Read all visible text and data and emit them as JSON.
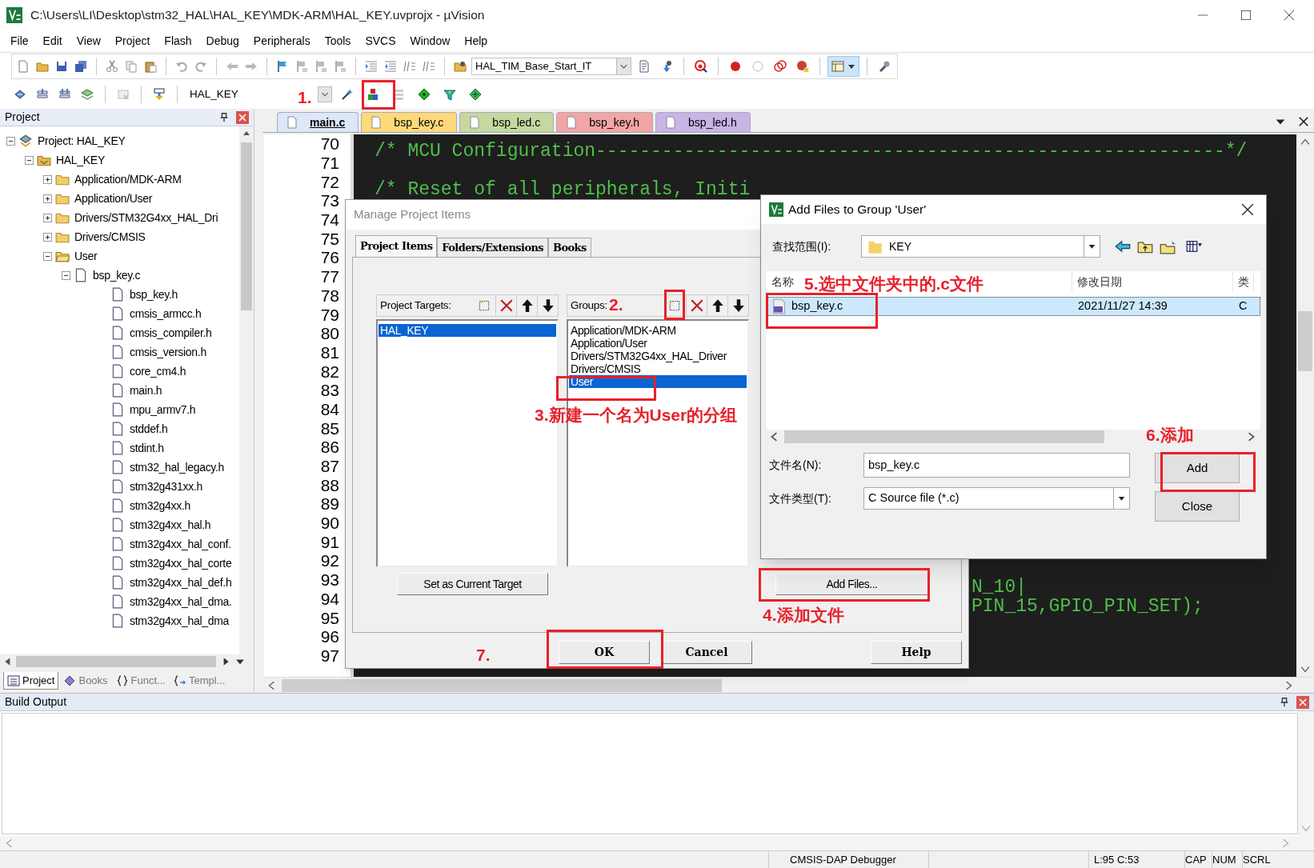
{
  "window": {
    "title": "C:\\Users\\LI\\Desktop\\stm32_HAL\\HAL_KEY\\MDK-ARM\\HAL_KEY.uvprojx - µVision"
  },
  "menu": [
    "File",
    "Edit",
    "View",
    "Project",
    "Flash",
    "Debug",
    "Peripherals",
    "Tools",
    "SVCS",
    "Window",
    "Help"
  ],
  "toolbar": {
    "find_combo": "HAL_TIM_Base_Start_IT",
    "target_combo": "HAL_KEY"
  },
  "project_panel": {
    "title": "Project",
    "tree": [
      {
        "label": "Project: HAL_KEY",
        "kind": "project",
        "expanded": true,
        "children": [
          {
            "label": "HAL_KEY",
            "kind": "target",
            "expanded": true,
            "children": [
              {
                "label": "Application/MDK-ARM",
                "kind": "group",
                "expanded": false
              },
              {
                "label": "Application/User",
                "kind": "group",
                "expanded": false
              },
              {
                "label": "Drivers/STM32G4xx_HAL_Dri",
                "kind": "group",
                "expanded": false
              },
              {
                "label": "Drivers/CMSIS",
                "kind": "group",
                "expanded": false
              },
              {
                "label": "User",
                "kind": "group",
                "expanded": true,
                "children": [
                  {
                    "label": "bsp_key.c",
                    "kind": "file",
                    "expanded": true,
                    "children": [
                      {
                        "label": "bsp_key.h",
                        "kind": "header"
                      },
                      {
                        "label": "cmsis_armcc.h",
                        "kind": "header"
                      },
                      {
                        "label": "cmsis_compiler.h",
                        "kind": "header"
                      },
                      {
                        "label": "cmsis_version.h",
                        "kind": "header"
                      },
                      {
                        "label": "core_cm4.h",
                        "kind": "header"
                      },
                      {
                        "label": "main.h",
                        "kind": "header"
                      },
                      {
                        "label": "mpu_armv7.h",
                        "kind": "header"
                      },
                      {
                        "label": "stddef.h",
                        "kind": "header"
                      },
                      {
                        "label": "stdint.h",
                        "kind": "header"
                      },
                      {
                        "label": "stm32_hal_legacy.h",
                        "kind": "header"
                      },
                      {
                        "label": "stm32g431xx.h",
                        "kind": "header"
                      },
                      {
                        "label": "stm32g4xx.h",
                        "kind": "header"
                      },
                      {
                        "label": "stm32g4xx_hal.h",
                        "kind": "header"
                      },
                      {
                        "label": "stm32g4xx_hal_conf.",
                        "kind": "header"
                      },
                      {
                        "label": "stm32g4xx_hal_corte",
                        "kind": "header"
                      },
                      {
                        "label": "stm32g4xx_hal_def.h",
                        "kind": "header"
                      },
                      {
                        "label": "stm32g4xx_hal_dma.",
                        "kind": "header"
                      },
                      {
                        "label": "stm32g4xx_hal_dma",
                        "kind": "header"
                      }
                    ]
                  }
                ]
              }
            ]
          }
        ]
      }
    ],
    "tabs": [
      {
        "label": "Project",
        "selected": true
      },
      {
        "label": "Books",
        "selected": false
      },
      {
        "label": "Funct...",
        "selected": false
      },
      {
        "label": "Templ...",
        "selected": false
      }
    ]
  },
  "editor": {
    "tabs": [
      {
        "label": "main.c",
        "selected": true,
        "color": "#dce7f7"
      },
      {
        "label": "bsp_key.c",
        "selected": false,
        "color": "#fdd97a"
      },
      {
        "label": "bsp_led.c",
        "selected": false,
        "color": "#c4d8a0"
      },
      {
        "label": "bsp_key.h",
        "selected": false,
        "color": "#f2a5a5"
      },
      {
        "label": "bsp_led.h",
        "selected": false,
        "color": "#c8b4e6"
      }
    ],
    "lines": [
      {
        "number": "70",
        "kind": "full",
        "code": "/* MCU Configuration---------------------------------------------------------*/"
      },
      {
        "number": "71"
      },
      {
        "number": "72",
        "kind": "full",
        "code": "/* Reset of all peripherals, Initi"
      },
      {
        "number": "73"
      },
      {
        "number": "74"
      },
      {
        "number": "75"
      },
      {
        "number": "76"
      },
      {
        "number": "77"
      },
      {
        "number": "78"
      },
      {
        "number": "79"
      },
      {
        "number": "80"
      },
      {
        "number": "81"
      },
      {
        "number": "82"
      },
      {
        "number": "83"
      },
      {
        "number": "84"
      },
      {
        "number": "85"
      },
      {
        "number": "86"
      },
      {
        "number": "87"
      },
      {
        "number": "88"
      },
      {
        "number": "89"
      },
      {
        "number": "90"
      },
      {
        "number": "91"
      },
      {
        "number": "92"
      },
      {
        "number": "93",
        "kind": "partial",
        "code": "N_10|"
      },
      {
        "number": "94",
        "kind": "partial",
        "code": "PIN_15,GPIO_PIN_SET);"
      },
      {
        "number": "95"
      },
      {
        "number": "96"
      },
      {
        "number": "97"
      }
    ]
  },
  "manage_dialog": {
    "title": "Manage Project Items",
    "tabs": [
      {
        "label": "Project Items",
        "selected": true
      },
      {
        "label": "Folders/Extensions",
        "selected": false
      },
      {
        "label": "Books",
        "selected": false
      }
    ],
    "targets": {
      "label": "Project Targets:",
      "items": [
        {
          "label": "HAL_KEY",
          "selected": true
        }
      ]
    },
    "groups": {
      "label": "Groups:",
      "items": [
        {
          "label": "Application/MDK-ARM",
          "selected": false
        },
        {
          "label": "Application/User",
          "selected": false
        },
        {
          "label": "Drivers/STM32G4xx_HAL_Driver",
          "selected": false
        },
        {
          "label": "Drivers/CMSIS",
          "selected": false
        },
        {
          "label": "User",
          "selected": true
        }
      ]
    },
    "set_target_button": "Set as Current Target",
    "add_files_button": "Add Files...",
    "buttons": [
      "OK",
      "Cancel",
      "Help"
    ]
  },
  "add_files_dialog": {
    "title": "Add Files to Group 'User'",
    "look_in_label": "查找范围(I):",
    "look_in": "KEY",
    "columns": [
      "名称",
      "修改日期",
      "类"
    ],
    "files": [
      {
        "name": "bsp_key.c",
        "modified": "2021/11/27 14:39",
        "type": "C",
        "selected": true
      }
    ],
    "file_name_label": "文件名(N):",
    "file_name": "bsp_key.c",
    "file_type_label": "文件类型(T):",
    "file_type": "C Source file (*.c)",
    "buttons": [
      "Add",
      "Close"
    ]
  },
  "annotations": [
    {
      "text": "1."
    },
    {
      "text": "2."
    },
    {
      "text": "3.新建一个名为User的分组"
    },
    {
      "text": "4.添加文件"
    },
    {
      "text": "5.选中文件夹中的.c文件"
    },
    {
      "text": "6.添加"
    },
    {
      "text": "7."
    }
  ],
  "build_output": {
    "title": "Build Output"
  },
  "status_bar": [
    "CMSIS-DAP Debugger",
    "L:95 C:53",
    "CAP",
    "NUM",
    "SCRL"
  ]
}
